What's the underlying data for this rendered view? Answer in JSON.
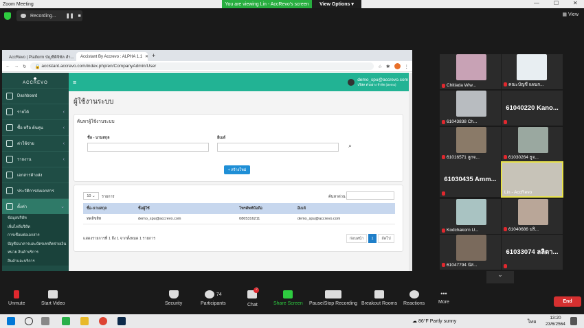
{
  "zoom": {
    "window_title": "Zoom Meeting",
    "viewing_text": "You are viewing Lin - AccRevo's screen",
    "view_options": "View Options ▾",
    "recording_label": "Recording...",
    "view_label": "View",
    "controls": [
      {
        "label": "Unmute",
        "icon": "microphone-muted-icon"
      },
      {
        "label": "Start Video",
        "icon": "video-off-icon"
      },
      {
        "label": "Security",
        "icon": "shield-icon"
      },
      {
        "label": "Participants",
        "icon": "participants-icon",
        "count": "74"
      },
      {
        "label": "Chat",
        "icon": "chat-icon",
        "badge": "2"
      },
      {
        "label": "Share Screen",
        "icon": "share-screen-icon"
      },
      {
        "label": "Pause/Stop Recording",
        "icon": "pause-icon"
      },
      {
        "label": "Breakout Rooms",
        "icon": "breakout-icon"
      },
      {
        "label": "Reactions",
        "icon": "reactions-icon"
      },
      {
        "label": "More",
        "icon": "more-icon"
      }
    ],
    "end_label": "End",
    "participants": [
      {
        "name": "Chitlada Wiw..."
      },
      {
        "name": "คณะบัญชี แผนก..."
      },
      {
        "name": "61043838 Ch..."
      },
      {
        "name": "61040220  Kano...",
        "big": true
      },
      {
        "name": "61016571 ลูกจ..."
      },
      {
        "name": "61030264 ธูจ..."
      },
      {
        "name": "61030435  Amm...",
        "big": true
      },
      {
        "name": "Lin - AccRevo"
      },
      {
        "name": "Kodchakorn U..."
      },
      {
        "name": "61040686 นริ..."
      },
      {
        "name": "61047794 นัส..."
      },
      {
        "name": "61033074  ลลิตา...",
        "big": true
      }
    ]
  },
  "browser": {
    "tabs": [
      "AccRevo | Platform บัญชีดิจิทัล สำ...",
      "Accistant By Accrevo : ALPHA 1.1"
    ],
    "url": "accistant.accrevo.com/index.php/en/CompanyAdmin/User"
  },
  "app": {
    "logo": "ACCREVO",
    "menu": [
      {
        "label": "Dashboard"
      },
      {
        "label": "รายได้"
      },
      {
        "label": "ซื้อ หรือ ต้นทุน"
      },
      {
        "label": "ค่าใช้จ่าย"
      },
      {
        "label": "รายงาน"
      },
      {
        "label": "เอกสารค้างส่ง"
      },
      {
        "label": "ประวัติการส่งเอกสาร"
      },
      {
        "label": "ตั้งค่า"
      }
    ],
    "submenu": [
      "ข้อมูลบริษัท",
      "เพิ่มไฟล์บริษัท",
      "การเชื่อมต่อเอกสาร",
      "บัญชีธนาคารและบัตรเครดิตจ่ายเงิน",
      "หน่วย สินค้าบริการ",
      "สินค้าและบริการ"
    ],
    "user_email": "demo_spu@accrevo.com",
    "user_company": "บริษัท ตัวอย่าง จำกัด (Demo)",
    "page_title": "ผู้ใช้งานระบบ",
    "search_title": "ค้นหาผู้ใช้งานระบบ",
    "name_label": "ชื่อ - นามสกุล",
    "email_label": "อีเมล์",
    "create_button": "+ สร้างใหม่",
    "page_size": "10",
    "records_label": "รายการ",
    "search_label": "ค้นหาด่วน",
    "columns": [
      "ชื่อ-นามสกุล",
      "ชื่อผู้ใช้",
      "โทรศัพท์มือถือ",
      "อีเมล์"
    ],
    "rows": [
      [
        "ทดลิขสิท",
        "demo_spu@accrevo.com",
        "0865316211",
        "demo_spu@accrevo.com"
      ]
    ],
    "summary": "แสดงรายการที่ 1 ถึง 1 จากทั้งหมด 1 รายการ",
    "prev": "ก่อนหน้า",
    "page": "1",
    "next": "ถัดไป"
  },
  "taskbar": {
    "weather": "86°F  Partly sunny",
    "lang": "ไทย",
    "time": "13:20",
    "date": "23/6/2564"
  }
}
